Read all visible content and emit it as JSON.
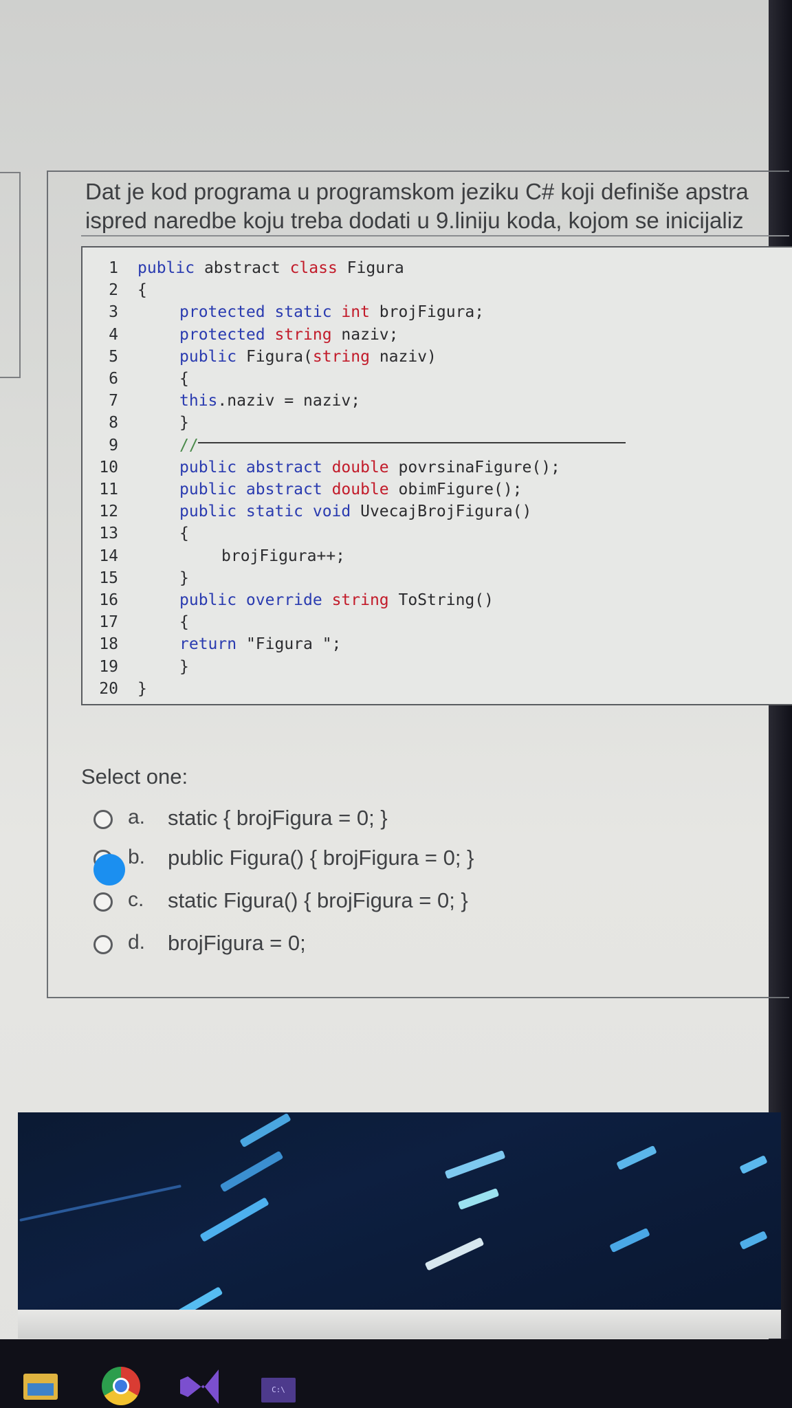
{
  "question": {
    "line1": "Dat je kod programa u programskom jeziku C# koji definiše apstra",
    "line2": "ispred naredbe koju treba dodati u 9.liniju koda, kojom se inicijaliz"
  },
  "code": [
    {
      "n": "1",
      "tokens": [
        [
          "kw",
          "public "
        ],
        [
          "id",
          "abstract "
        ],
        [
          "ty",
          "class "
        ],
        [
          "id",
          "Figura"
        ]
      ],
      "indent": 0
    },
    {
      "n": "2",
      "tokens": [
        [
          "id",
          "{"
        ]
      ],
      "indent": 0
    },
    {
      "n": "3",
      "tokens": [
        [
          "kw",
          "protected static "
        ],
        [
          "ty",
          "int "
        ],
        [
          "id",
          "brojFigura;"
        ]
      ],
      "indent": 2
    },
    {
      "n": "4",
      "tokens": [
        [
          "kw",
          "protected "
        ],
        [
          "ty",
          "string "
        ],
        [
          "id",
          "naziv;"
        ]
      ],
      "indent": 2
    },
    {
      "n": "5",
      "tokens": [
        [
          "kw",
          "public "
        ],
        [
          "id",
          "Figura("
        ],
        [
          "ty",
          "string "
        ],
        [
          "id",
          "naziv)"
        ]
      ],
      "indent": 2
    },
    {
      "n": "6",
      "tokens": [
        [
          "id",
          "{"
        ]
      ],
      "indent": 2
    },
    {
      "n": "7",
      "tokens": [
        [
          "kw",
          "this"
        ],
        [
          "id",
          ".naziv = naziv;"
        ]
      ],
      "indent": 2
    },
    {
      "n": "8",
      "tokens": [
        [
          "id",
          "}"
        ]
      ],
      "indent": 2
    },
    {
      "n": "9",
      "tokens": [
        [
          "cm",
          "//"
        ]
      ],
      "indent": 2
    },
    {
      "n": "10",
      "tokens": [
        [
          "kw",
          "public abstract "
        ],
        [
          "ty",
          "double "
        ],
        [
          "id",
          "povrsinaFigure();"
        ]
      ],
      "indent": 2
    },
    {
      "n": "11",
      "tokens": [
        [
          "kw",
          "public abstract "
        ],
        [
          "ty",
          "double "
        ],
        [
          "id",
          "obimFigure();"
        ]
      ],
      "indent": 2
    },
    {
      "n": "12",
      "tokens": [
        [
          "kw",
          "public static void "
        ],
        [
          "id",
          "UvecajBrojFigura()"
        ]
      ],
      "indent": 2
    },
    {
      "n": "13",
      "tokens": [
        [
          "id",
          "{"
        ]
      ],
      "indent": 2
    },
    {
      "n": "14",
      "tokens": [
        [
          "id",
          "brojFigura++;"
        ]
      ],
      "indent": 4
    },
    {
      "n": "15",
      "tokens": [
        [
          "id",
          "}"
        ]
      ],
      "indent": 2
    },
    {
      "n": "16",
      "tokens": [
        [
          "kw",
          "public override "
        ],
        [
          "ty",
          "string "
        ],
        [
          "id",
          "ToString()"
        ]
      ],
      "indent": 2
    },
    {
      "n": "17",
      "tokens": [
        [
          "id",
          "{"
        ]
      ],
      "indent": 2
    },
    {
      "n": "18",
      "tokens": [
        [
          "kw",
          "return "
        ],
        [
          "id",
          "\"Figura \";"
        ]
      ],
      "indent": 2
    },
    {
      "n": "19",
      "tokens": [
        [
          "id",
          "}"
        ]
      ],
      "indent": 2
    },
    {
      "n": "20",
      "tokens": [
        [
          "id",
          "}"
        ]
      ],
      "indent": 0
    }
  ],
  "select_label": "Select one:",
  "options": [
    {
      "letter": "a.",
      "text": "static { brojFigura = 0; }"
    },
    {
      "letter": "b.",
      "text": "public Figura() { brojFigura = 0; }"
    },
    {
      "letter": "c.",
      "text": "static Figura() { brojFigura = 0; }"
    },
    {
      "letter": "d.",
      "text": "brojFigura = 0;"
    }
  ],
  "colors": {
    "keyword": "#2a3bb0",
    "type": "#c21b2a",
    "touch_indicator": "#1b8ff0"
  },
  "taskbar": {
    "icons": [
      "folder-icon",
      "chrome-icon",
      "visual-studio-icon",
      "terminal-icon"
    ],
    "terminal_label": "C:\\"
  }
}
